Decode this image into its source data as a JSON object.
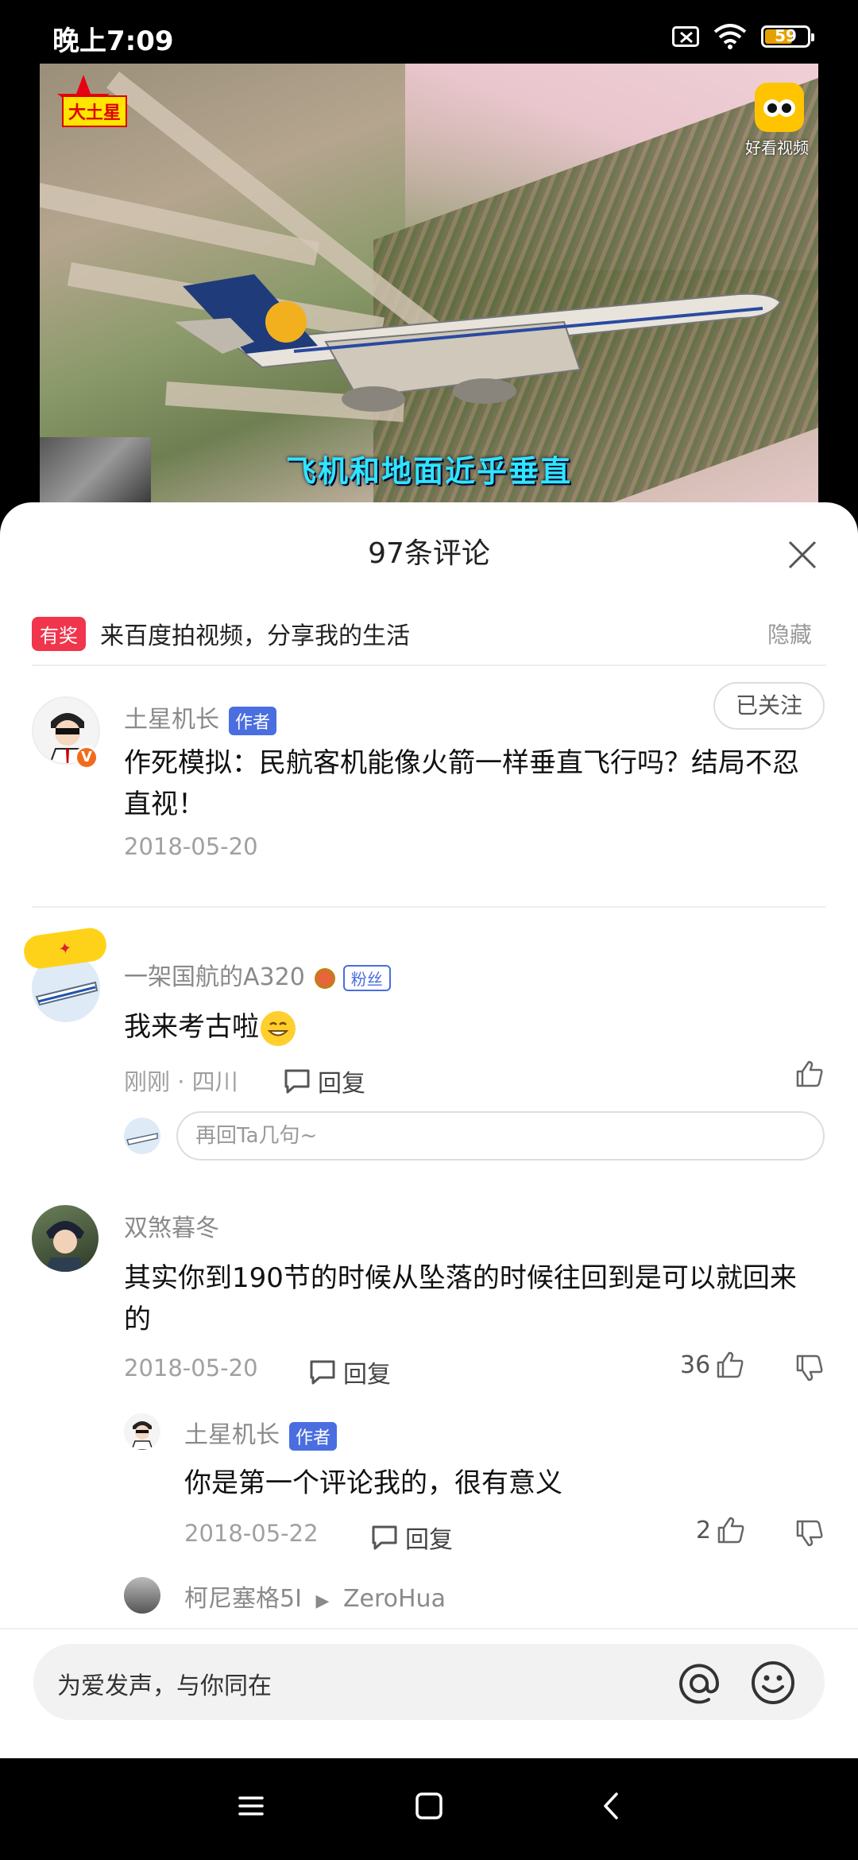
{
  "status_bar": {
    "time": "晚上7:09",
    "battery": "59"
  },
  "video": {
    "channel_tag": "大土星",
    "app_watermark": "好看视频",
    "subtitle": "飞机和地面近乎垂直"
  },
  "comments_sheet": {
    "title": "97条评论",
    "promo": {
      "badge": "有奖",
      "text": "来百度拍视频，分享我的生活",
      "hide_label": "隐藏"
    },
    "author_post": {
      "username": "土星机长",
      "badge": "作者",
      "follow_label": "已关注",
      "text": "作死模拟：民航客机能像火箭一样垂直飞行吗？结局不忍直视！",
      "date": "2018-05-20"
    },
    "comments": [
      {
        "username": "一架国航的A320",
        "badge": "粉丝",
        "text": "我来考古啦",
        "meta": "刚刚 · 四川",
        "reply_label": "回复",
        "reply_placeholder": "再回Ta几句~"
      },
      {
        "username": "双煞暮冬",
        "text": "其实你到190节的时候从坠落的时候往回到是可以就回来的",
        "date": "2018-05-20",
        "reply_label": "回复",
        "likes": "36",
        "replies": [
          {
            "username": "土星机长",
            "badge": "作者",
            "text": "你是第一个评论我的，很有意义",
            "date": "2018-05-22",
            "reply_label": "回复",
            "likes": "2"
          }
        ],
        "more_reply": {
          "from": "柯尼塞格5I",
          "to": "ZeroHua"
        }
      }
    ]
  },
  "input_bar": {
    "placeholder": "为爱发声，与你同在"
  },
  "colors": {
    "author_badge": "#4a6ee0",
    "promo_badge": "#f0354c",
    "subtitle": "#2ee6ff"
  }
}
